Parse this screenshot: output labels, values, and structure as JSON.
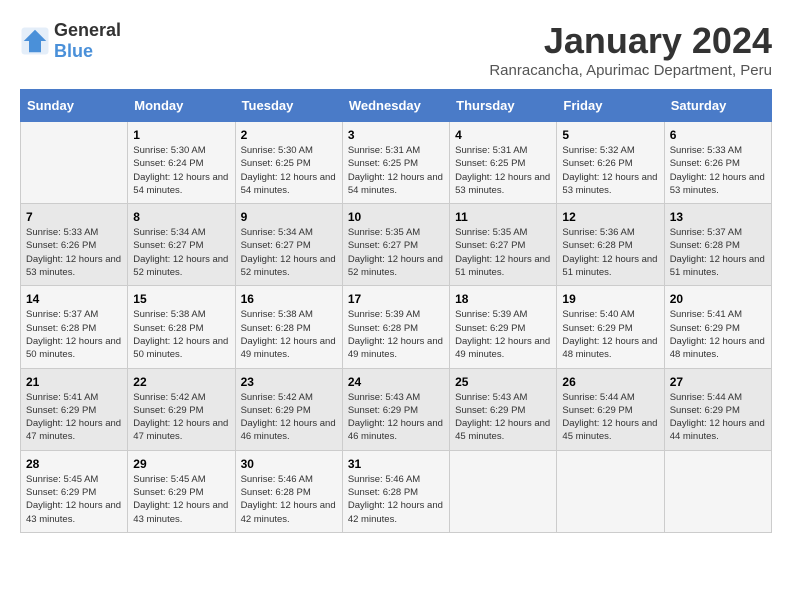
{
  "logo": {
    "general": "General",
    "blue": "Blue"
  },
  "title": "January 2024",
  "location": "Ranracancha, Apurimac Department, Peru",
  "days_of_week": [
    "Sunday",
    "Monday",
    "Tuesday",
    "Wednesday",
    "Thursday",
    "Friday",
    "Saturday"
  ],
  "weeks": [
    [
      {
        "day": "",
        "sunrise": "",
        "sunset": "",
        "daylight": ""
      },
      {
        "day": "1",
        "sunrise": "Sunrise: 5:30 AM",
        "sunset": "Sunset: 6:24 PM",
        "daylight": "Daylight: 12 hours and 54 minutes."
      },
      {
        "day": "2",
        "sunrise": "Sunrise: 5:30 AM",
        "sunset": "Sunset: 6:25 PM",
        "daylight": "Daylight: 12 hours and 54 minutes."
      },
      {
        "day": "3",
        "sunrise": "Sunrise: 5:31 AM",
        "sunset": "Sunset: 6:25 PM",
        "daylight": "Daylight: 12 hours and 54 minutes."
      },
      {
        "day": "4",
        "sunrise": "Sunrise: 5:31 AM",
        "sunset": "Sunset: 6:25 PM",
        "daylight": "Daylight: 12 hours and 53 minutes."
      },
      {
        "day": "5",
        "sunrise": "Sunrise: 5:32 AM",
        "sunset": "Sunset: 6:26 PM",
        "daylight": "Daylight: 12 hours and 53 minutes."
      },
      {
        "day": "6",
        "sunrise": "Sunrise: 5:33 AM",
        "sunset": "Sunset: 6:26 PM",
        "daylight": "Daylight: 12 hours and 53 minutes."
      }
    ],
    [
      {
        "day": "7",
        "sunrise": "Sunrise: 5:33 AM",
        "sunset": "Sunset: 6:26 PM",
        "daylight": "Daylight: 12 hours and 53 minutes."
      },
      {
        "day": "8",
        "sunrise": "Sunrise: 5:34 AM",
        "sunset": "Sunset: 6:27 PM",
        "daylight": "Daylight: 12 hours and 52 minutes."
      },
      {
        "day": "9",
        "sunrise": "Sunrise: 5:34 AM",
        "sunset": "Sunset: 6:27 PM",
        "daylight": "Daylight: 12 hours and 52 minutes."
      },
      {
        "day": "10",
        "sunrise": "Sunrise: 5:35 AM",
        "sunset": "Sunset: 6:27 PM",
        "daylight": "Daylight: 12 hours and 52 minutes."
      },
      {
        "day": "11",
        "sunrise": "Sunrise: 5:35 AM",
        "sunset": "Sunset: 6:27 PM",
        "daylight": "Daylight: 12 hours and 51 minutes."
      },
      {
        "day": "12",
        "sunrise": "Sunrise: 5:36 AM",
        "sunset": "Sunset: 6:28 PM",
        "daylight": "Daylight: 12 hours and 51 minutes."
      },
      {
        "day": "13",
        "sunrise": "Sunrise: 5:37 AM",
        "sunset": "Sunset: 6:28 PM",
        "daylight": "Daylight: 12 hours and 51 minutes."
      }
    ],
    [
      {
        "day": "14",
        "sunrise": "Sunrise: 5:37 AM",
        "sunset": "Sunset: 6:28 PM",
        "daylight": "Daylight: 12 hours and 50 minutes."
      },
      {
        "day": "15",
        "sunrise": "Sunrise: 5:38 AM",
        "sunset": "Sunset: 6:28 PM",
        "daylight": "Daylight: 12 hours and 50 minutes."
      },
      {
        "day": "16",
        "sunrise": "Sunrise: 5:38 AM",
        "sunset": "Sunset: 6:28 PM",
        "daylight": "Daylight: 12 hours and 49 minutes."
      },
      {
        "day": "17",
        "sunrise": "Sunrise: 5:39 AM",
        "sunset": "Sunset: 6:28 PM",
        "daylight": "Daylight: 12 hours and 49 minutes."
      },
      {
        "day": "18",
        "sunrise": "Sunrise: 5:39 AM",
        "sunset": "Sunset: 6:29 PM",
        "daylight": "Daylight: 12 hours and 49 minutes."
      },
      {
        "day": "19",
        "sunrise": "Sunrise: 5:40 AM",
        "sunset": "Sunset: 6:29 PM",
        "daylight": "Daylight: 12 hours and 48 minutes."
      },
      {
        "day": "20",
        "sunrise": "Sunrise: 5:41 AM",
        "sunset": "Sunset: 6:29 PM",
        "daylight": "Daylight: 12 hours and 48 minutes."
      }
    ],
    [
      {
        "day": "21",
        "sunrise": "Sunrise: 5:41 AM",
        "sunset": "Sunset: 6:29 PM",
        "daylight": "Daylight: 12 hours and 47 minutes."
      },
      {
        "day": "22",
        "sunrise": "Sunrise: 5:42 AM",
        "sunset": "Sunset: 6:29 PM",
        "daylight": "Daylight: 12 hours and 47 minutes."
      },
      {
        "day": "23",
        "sunrise": "Sunrise: 5:42 AM",
        "sunset": "Sunset: 6:29 PM",
        "daylight": "Daylight: 12 hours and 46 minutes."
      },
      {
        "day": "24",
        "sunrise": "Sunrise: 5:43 AM",
        "sunset": "Sunset: 6:29 PM",
        "daylight": "Daylight: 12 hours and 46 minutes."
      },
      {
        "day": "25",
        "sunrise": "Sunrise: 5:43 AM",
        "sunset": "Sunset: 6:29 PM",
        "daylight": "Daylight: 12 hours and 45 minutes."
      },
      {
        "day": "26",
        "sunrise": "Sunrise: 5:44 AM",
        "sunset": "Sunset: 6:29 PM",
        "daylight": "Daylight: 12 hours and 45 minutes."
      },
      {
        "day": "27",
        "sunrise": "Sunrise: 5:44 AM",
        "sunset": "Sunset: 6:29 PM",
        "daylight": "Daylight: 12 hours and 44 minutes."
      }
    ],
    [
      {
        "day": "28",
        "sunrise": "Sunrise: 5:45 AM",
        "sunset": "Sunset: 6:29 PM",
        "daylight": "Daylight: 12 hours and 43 minutes."
      },
      {
        "day": "29",
        "sunrise": "Sunrise: 5:45 AM",
        "sunset": "Sunset: 6:29 PM",
        "daylight": "Daylight: 12 hours and 43 minutes."
      },
      {
        "day": "30",
        "sunrise": "Sunrise: 5:46 AM",
        "sunset": "Sunset: 6:28 PM",
        "daylight": "Daylight: 12 hours and 42 minutes."
      },
      {
        "day": "31",
        "sunrise": "Sunrise: 5:46 AM",
        "sunset": "Sunset: 6:28 PM",
        "daylight": "Daylight: 12 hours and 42 minutes."
      },
      {
        "day": "",
        "sunrise": "",
        "sunset": "",
        "daylight": ""
      },
      {
        "day": "",
        "sunrise": "",
        "sunset": "",
        "daylight": ""
      },
      {
        "day": "",
        "sunrise": "",
        "sunset": "",
        "daylight": ""
      }
    ]
  ]
}
